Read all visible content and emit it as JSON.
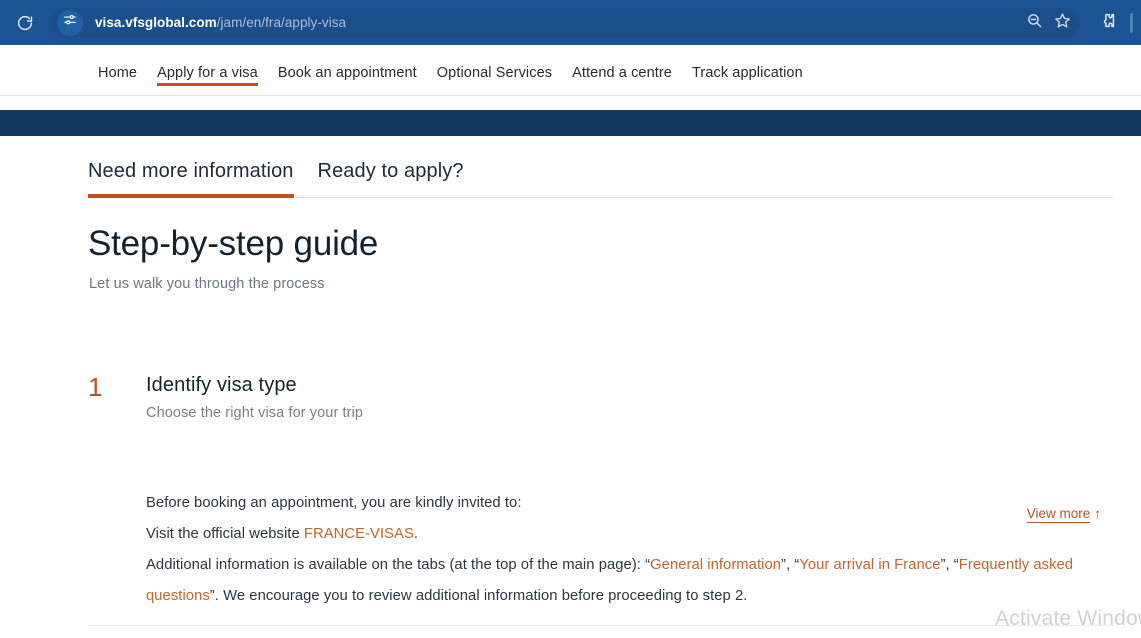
{
  "browser": {
    "reload_icon": "reload-icon",
    "site_info_icon": "tune-site-settings-icon",
    "url_domain": "visa.vfsglobal.com",
    "url_path": "/jam/en/fra/apply-visa",
    "zoom_icon": "zoom-search-icon",
    "bookmark_icon": "star-bookmark-icon",
    "extensions_icon": "puzzle-extensions-icon"
  },
  "site_nav": {
    "items": [
      {
        "label": "Home",
        "active": false
      },
      {
        "label": "Apply for a visa",
        "active": true
      },
      {
        "label": "Book an appointment",
        "active": false
      },
      {
        "label": "Optional Services",
        "active": false
      },
      {
        "label": "Attend a centre",
        "active": false
      },
      {
        "label": "Track application",
        "active": false
      }
    ]
  },
  "content": {
    "tabs": [
      {
        "label": "Need more information",
        "active": true
      },
      {
        "label": "Ready to apply?",
        "active": false
      }
    ],
    "title": "Step-by-step guide",
    "subtitle": "Let us walk you through the process",
    "view_more_label": "View more",
    "view_more_arrow": "↑",
    "step": {
      "number": "1",
      "title": "Identify visa type",
      "description": "Choose the right visa for your trip",
      "paragraph_1": "Before booking an appointment, you are kindly invited to:",
      "paragraph_2_pre": "Visit the official website ",
      "paragraph_2_link": "FRANCE-VISAS",
      "paragraph_2_post": ".",
      "paragraph_3_a": "Additional information is available on the tabs (at the top of the main page): “",
      "paragraph_3_link1": "General information",
      "paragraph_3_b": "”, “",
      "paragraph_3_link2": "Your arrival in France",
      "paragraph_3_c": "”, “",
      "paragraph_3_link3": "Frequently asked questions",
      "paragraph_3_d": "”. We encourage you to review additional information before proceeding to step 2."
    }
  },
  "watermark": {
    "text": "Activate Window"
  },
  "colors": {
    "browser_bar": "#1b5393",
    "navy_band": "#13395e",
    "accent_orange": "#c1521f",
    "link_orange": "#c1662e",
    "body_text": "#2b3640",
    "muted_text": "#777f87"
  }
}
